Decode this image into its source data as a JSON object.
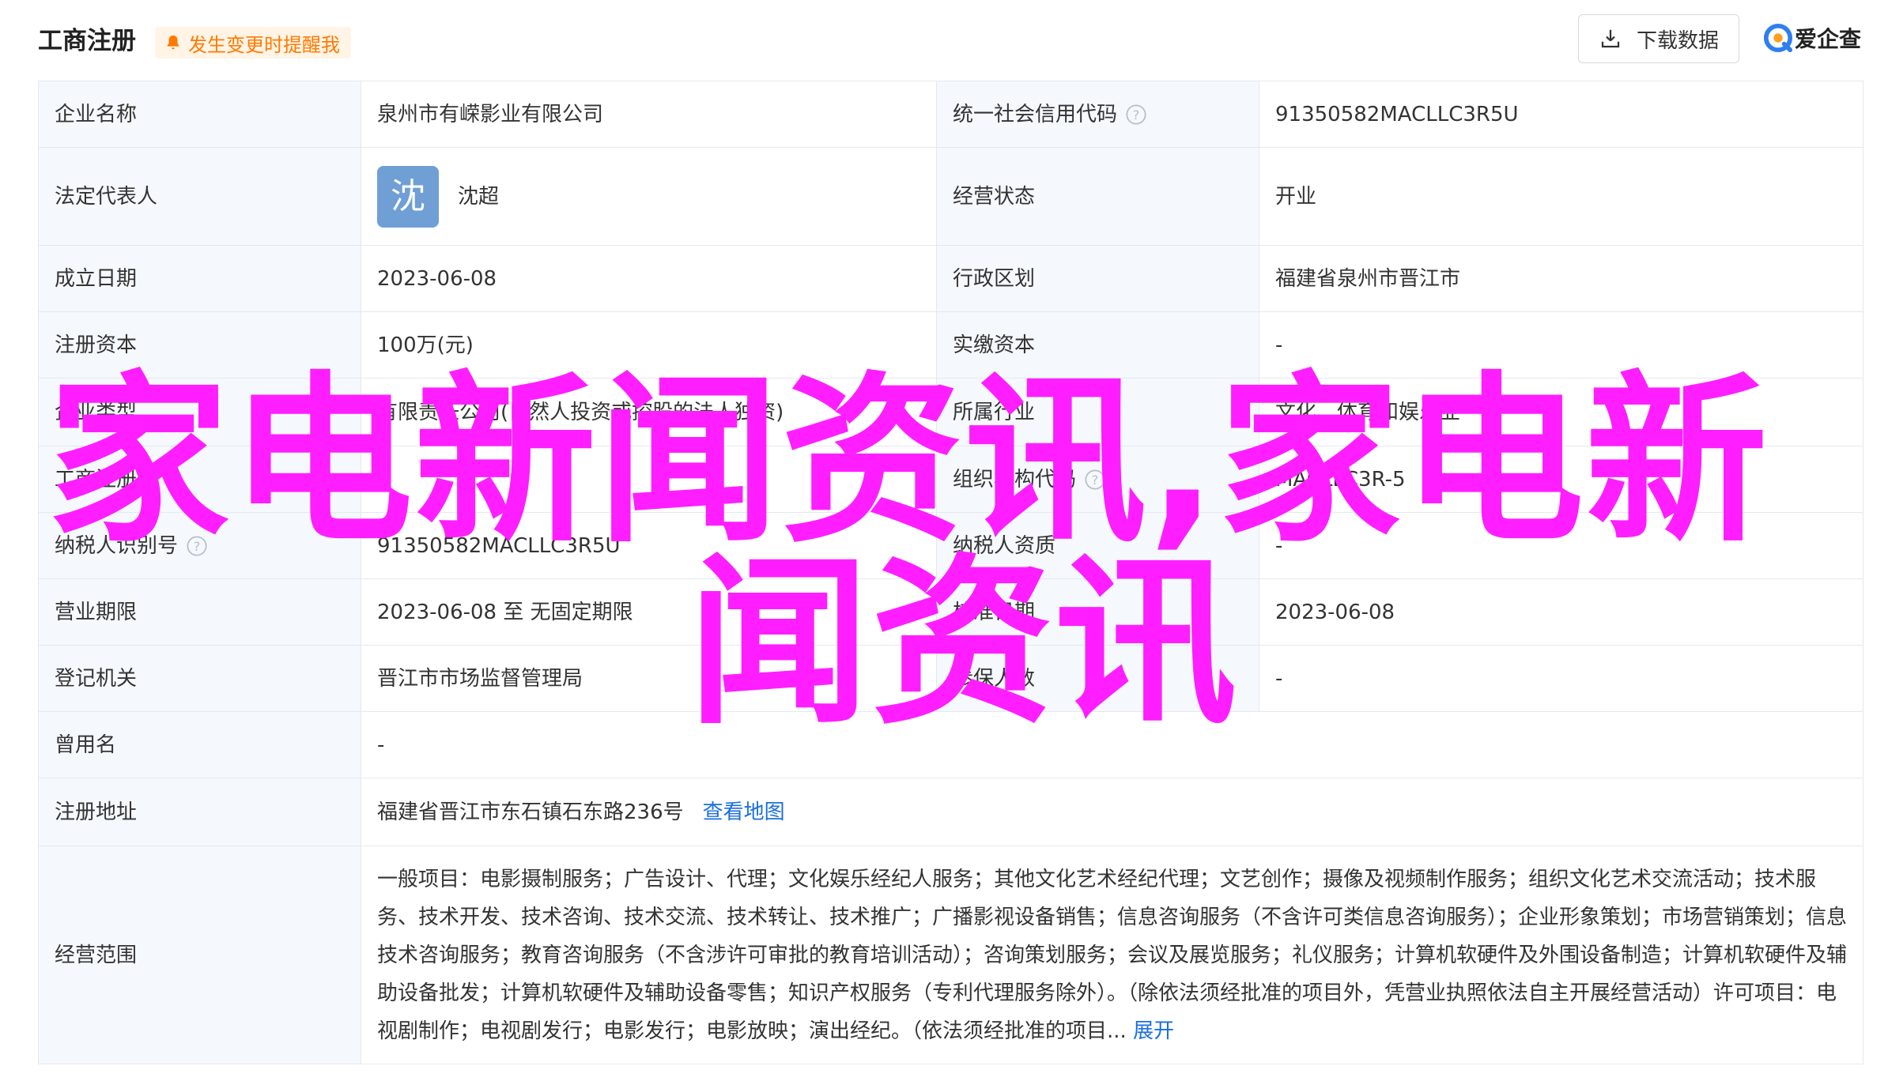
{
  "header": {
    "title": "工商注册",
    "alert_label": "发生变更时提醒我",
    "download_label": "下载数据",
    "brand_label": "爱企查"
  },
  "rows": {
    "company_name": {
      "label": "企业名称",
      "value": "泉州市有嵘影业有限公司"
    },
    "credit_code": {
      "label": "统一社会信用代码",
      "value": "91350582MACLLC3R5U"
    },
    "legal_rep": {
      "label": "法定代表人",
      "avatar_char": "沈",
      "value": "沈超"
    },
    "status": {
      "label": "经营状态",
      "value": "开业"
    },
    "founded": {
      "label": "成立日期",
      "value": "2023-06-08"
    },
    "region": {
      "label": "行政区划",
      "value": "福建省泉州市晋江市"
    },
    "reg_capital": {
      "label": "注册资本",
      "value": "100万(元)"
    },
    "paid_capital": {
      "label": "实缴资本",
      "value": "-"
    },
    "company_type": {
      "label": "企业类型",
      "value": "有限责任公司(自然人投资或控股的法人独资)"
    },
    "industry": {
      "label": "所属行业",
      "value": "文化、体育和娱乐业"
    },
    "biz_reg_no": {
      "label": "工商注册号",
      "value": ""
    },
    "org_code": {
      "label": "组织机构代码",
      "value": "MACLLC3R-5"
    },
    "taxpayer_id": {
      "label": "纳税人识别号",
      "value": "91350582MACLLC3R5U"
    },
    "taxpayer_quality": {
      "label": "纳税人资质",
      "value": "-"
    },
    "biz_term": {
      "label": "营业期限",
      "value": "2023-06-08 至 无固定期限"
    },
    "approval_date": {
      "label": "核准日期",
      "value": "2023-06-08"
    },
    "reg_authority": {
      "label": "登记机关",
      "value": "晋江市市场监督管理局"
    },
    "insured_count": {
      "label": "参保人数",
      "value": "-"
    },
    "former_name": {
      "label": "曾用名",
      "value": "-"
    },
    "reg_address": {
      "label": "注册地址",
      "value": "福建省晋江市东石镇石东路236号",
      "map_link": "查看地图"
    },
    "biz_scope": {
      "label": "经营范围",
      "value": "一般项目：电影摄制服务；广告设计、代理；文化娱乐经纪人服务；其他文化艺术经纪代理；文艺创作；摄像及视频制作服务；组织文化艺术交流活动；技术服务、技术开发、技术咨询、技术交流、技术转让、技术推广；广播影视设备销售；信息咨询服务（不含许可类信息咨询服务）；企业形象策划；市场营销策划；信息技术咨询服务；教育咨询服务（不含涉许可审批的教育培训活动）；咨询策划服务；会议及展览服务；礼仪服务；计算机软硬件及外围设备制造；计算机软硬件及辅助设备批发；计算机软硬件及辅助设备零售；知识产权服务（专利代理服务除外）。（除依法须经批准的项目外，凭营业执照依法自主开展经营活动）许可项目：电视剧制作；电视剧发行；电影发行；电影放映；演出经纪。（依法须经批准的项目",
      "ellipsis": "...",
      "expand_label": "展开"
    }
  },
  "overlay_text": {
    "line1": "家电新闻资讯,家电新",
    "line2": "闻资讯"
  },
  "colors": {
    "accent": "#1a6fdf",
    "alert": "#ff7a00",
    "overlay": "#ff1eff",
    "label_bg": "#f5f8fc",
    "avatar_bg": "#6f9fd4"
  },
  "icons": [
    "bell-icon",
    "download-icon",
    "brand-logo-icon",
    "help-icon"
  ]
}
